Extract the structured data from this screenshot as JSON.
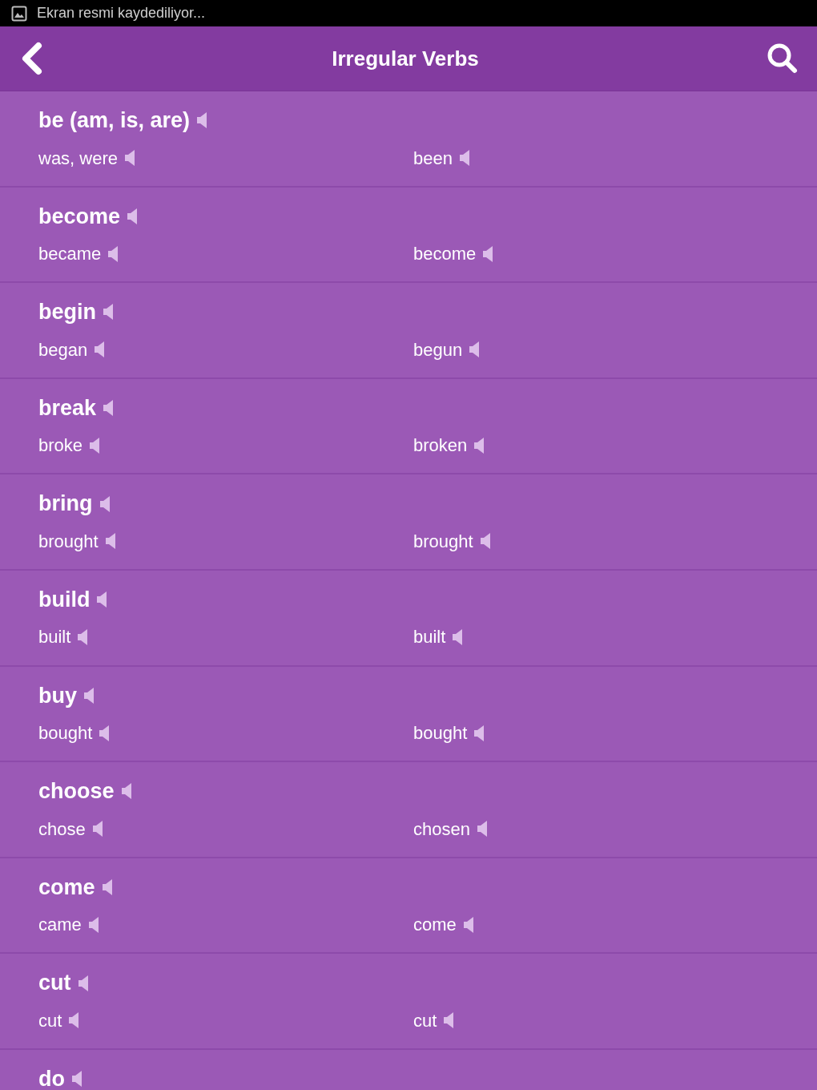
{
  "status_bar": {
    "text": "Ekran resmi kaydediliyor..."
  },
  "header": {
    "title": "Irregular Verbs"
  },
  "verbs": [
    {
      "base": "be (am, is, are)",
      "past": "was, were",
      "participle": "been"
    },
    {
      "base": "become",
      "past": "became",
      "participle": "become"
    },
    {
      "base": "begin",
      "past": "began",
      "participle": "begun"
    },
    {
      "base": "break",
      "past": "broke",
      "participle": "broken"
    },
    {
      "base": "bring",
      "past": "brought",
      "participle": "brought"
    },
    {
      "base": "build",
      "past": "built",
      "participle": "built"
    },
    {
      "base": "buy",
      "past": "bought",
      "participle": "bought"
    },
    {
      "base": "choose",
      "past": "chose",
      "participle": "chosen"
    },
    {
      "base": "come",
      "past": "came",
      "participle": "come"
    },
    {
      "base": "cut",
      "past": "cut",
      "participle": "cut"
    },
    {
      "base": "do"
    }
  ]
}
